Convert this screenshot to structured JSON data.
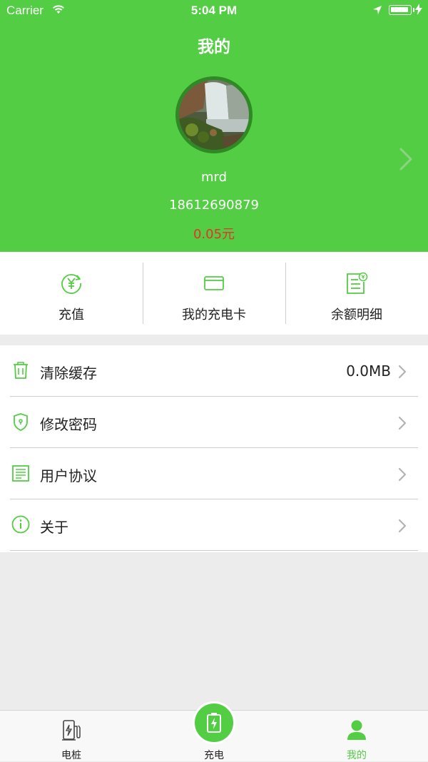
{
  "status_bar": {
    "carrier": "Carrier",
    "time": "5:04 PM"
  },
  "header": {
    "title": "我的",
    "username": "mrd",
    "phone": "18612690879",
    "balance": "0.05元"
  },
  "quick_actions": [
    {
      "label": "充值",
      "icon": "yuan-recharge-icon"
    },
    {
      "label": "我的充电卡",
      "icon": "card-icon"
    },
    {
      "label": "余额明细",
      "icon": "balance-detail-icon"
    }
  ],
  "settings": [
    {
      "label": "清除缓存",
      "value": "0.0MB",
      "icon": "trash-icon"
    },
    {
      "label": "修改密码",
      "value": "",
      "icon": "shield-icon"
    },
    {
      "label": "用户协议",
      "value": "",
      "icon": "document-icon"
    },
    {
      "label": "关于",
      "value": "",
      "icon": "info-icon"
    }
  ],
  "tabbar": {
    "items": [
      {
        "label": "电桩",
        "icon": "charging-pile-icon"
      },
      {
        "label": "充电",
        "icon": "battery-charge-icon"
      },
      {
        "label": "我的",
        "icon": "person-icon"
      }
    ]
  },
  "colors": {
    "brand": "#53cd43",
    "balance": "#e4332b"
  }
}
